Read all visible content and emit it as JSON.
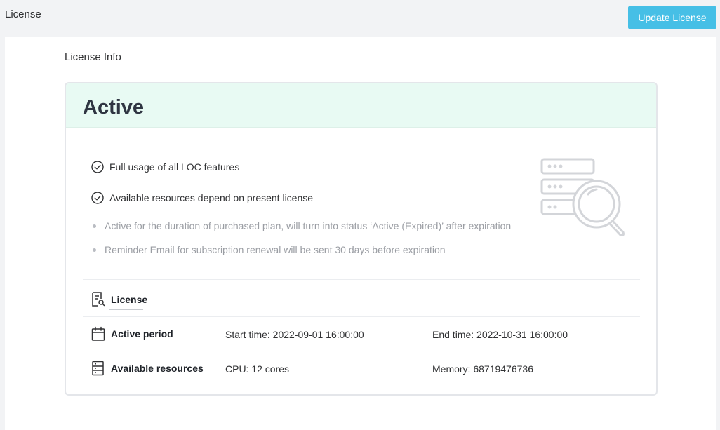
{
  "header": {
    "title": "License",
    "update_button": "Update License"
  },
  "section": {
    "title": "License Info"
  },
  "card": {
    "status": "Active",
    "features": [
      "Full usage of all LOC features",
      "Available resources depend on present license"
    ],
    "notes": [
      "Active for the duration of purchased plan, will turn into status ‘Active (Expired)’ after expiration",
      "Reminder Email for subscription renewal will be sent 30 days before expiration"
    ],
    "details": {
      "license_label": "License",
      "active_period": {
        "label": "Active period",
        "start": "Start time: 2022-09-01 16:00:00",
        "end": "End time: 2022-10-31 16:00:00"
      },
      "resources": {
        "label": "Available resources",
        "cpu": "CPU: 12 cores",
        "memory": "Memory: 68719476736"
      }
    },
    "icons": {
      "check": "check-circle-icon",
      "illustration": "server-search-icon",
      "license": "document-search-icon",
      "calendar": "calendar-icon",
      "resources": "server-list-icon"
    }
  },
  "colors": {
    "accent_button": "#46bfe6",
    "active_header_bg": "#e8faf3"
  }
}
